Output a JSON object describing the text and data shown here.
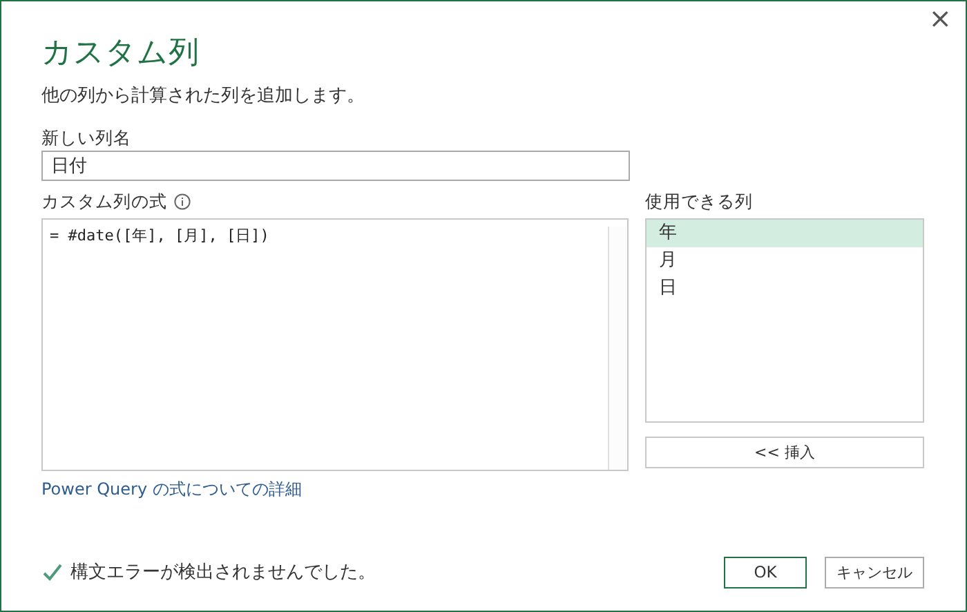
{
  "window": {
    "close": "×"
  },
  "title": "カスタム列",
  "subtitle": "他の列から計算された列を追加します。",
  "new_column_name": {
    "label": "新しい列名",
    "value": "日付"
  },
  "formula": {
    "label": "カスタム列の式",
    "value": "= #date([年], [月], [日])"
  },
  "available_columns": {
    "label": "使用できる列",
    "items": [
      {
        "label": "年",
        "selected": true
      },
      {
        "label": "月",
        "selected": false
      },
      {
        "label": "日",
        "selected": false
      }
    ],
    "insert_button": "<< 挿入"
  },
  "link": "Power Query の式についての詳細",
  "status": {
    "ok": true,
    "message": "構文エラーが検出されませんでした。"
  },
  "buttons": [
    {
      "label": "OK",
      "primary": true
    },
    {
      "label": "キャンセル",
      "primary": false
    }
  ]
}
